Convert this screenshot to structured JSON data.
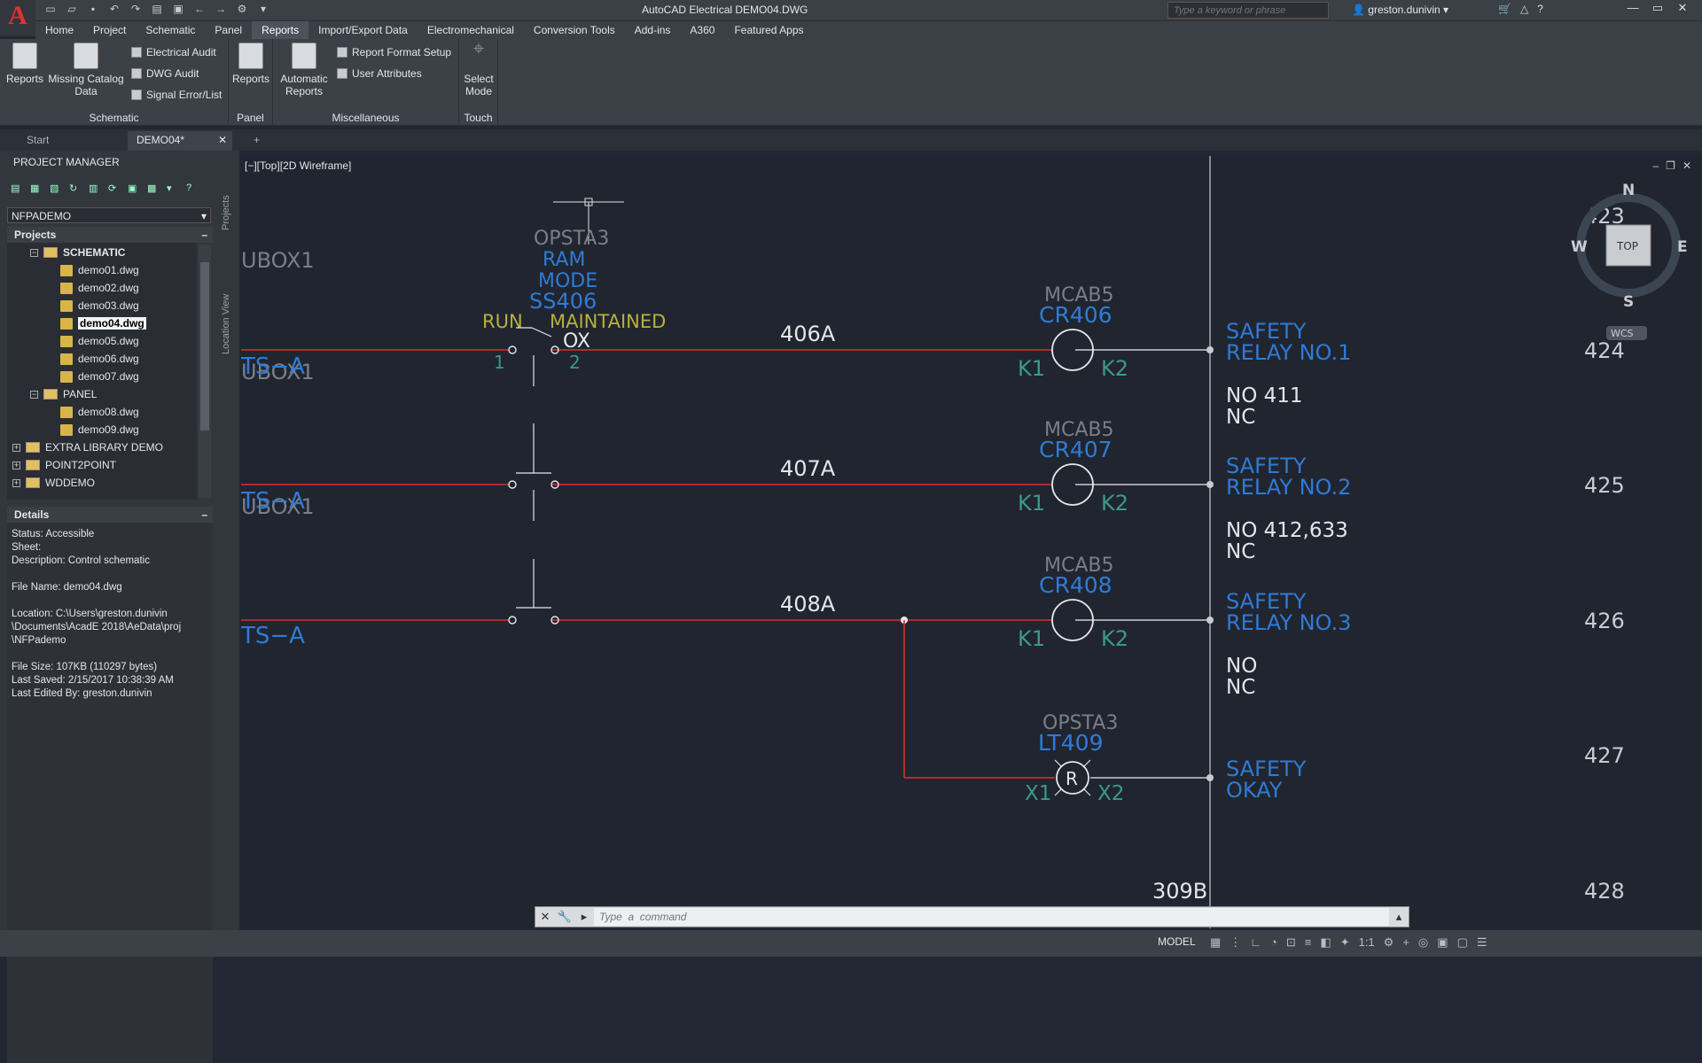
{
  "app": {
    "title": "AutoCAD Electrical   DEMO04.DWG",
    "logo": "A"
  },
  "search": {
    "placeholder": "Type a keyword or phrase"
  },
  "user": {
    "name": "greston.dunivin"
  },
  "menu": [
    "Home",
    "Project",
    "Schematic",
    "Panel",
    "Reports",
    "Import/Export Data",
    "Electromechanical",
    "Conversion Tools",
    "Add-ins",
    "A360",
    "Featured Apps"
  ],
  "menu_active": "Reports",
  "ribbon": {
    "schematic": {
      "label": "Schematic",
      "reports": "Reports",
      "missing": "Missing Catalog\nData",
      "audit": "Electrical Audit",
      "dwg_audit": "DWG Audit",
      "signal": "Signal Error/List"
    },
    "panel": {
      "label": "Panel",
      "reports": "Reports"
    },
    "misc": {
      "label": "Miscellaneous",
      "auto": "Automatic\nReports",
      "format": "Report Format Setup",
      "attrs": "User Attributes"
    },
    "touch": {
      "label": "Touch",
      "select": "Select\nMode"
    }
  },
  "tabs": {
    "start": "Start",
    "demo": "DEMO04*",
    "add": "+"
  },
  "pm": {
    "title": "PROJECT MANAGER",
    "project": "NFPADEMO",
    "projects_header": "Projects",
    "schematic": "SCHEMATIC",
    "files": [
      "demo01.dwg",
      "demo02.dwg",
      "demo03.dwg",
      "demo04.dwg",
      "demo05.dwg",
      "demo06.dwg",
      "demo07.dwg"
    ],
    "panel": "PANEL",
    "panel_files": [
      "demo08.dwg",
      "demo09.dwg"
    ],
    "others": [
      "EXTRA LIBRARY DEMO",
      "POINT2POINT",
      "WDDEMO"
    ],
    "side_projects": "Projects",
    "side_location": "Location View"
  },
  "details": {
    "header": "Details",
    "text": "Status: Accessible\nSheet:\nDescription: Control schematic\n\nFile Name: demo04.dwg\n\nLocation: C:\\Users\\greston.dunivin\n\\Documents\\AcadE 2018\\AeData\\proj\n\\NFPademo\n\nFile Size: 107KB (110297 bytes)\nLast Saved: 2/15/2017 10:38:39 AM\nLast Edited By: greston.dunivin"
  },
  "viewport": {
    "label": "[−][Top][2D Wireframe]"
  },
  "compass": {
    "n": "N",
    "s": "S",
    "e": "E",
    "w": "W",
    "top": "TOP",
    "wcs": "WCS"
  },
  "drawing": {
    "left_labels": {
      "ubox1": "UBOX1",
      "tsa": "TS−A"
    },
    "ss": {
      "tag1": "OPSTA3",
      "tag2": "RAM",
      "tag3": "MODE",
      "tag4": "SS406",
      "run": "RUN",
      "maintained": "MAINTAINED",
      "ox": "OX",
      "n1": "1",
      "n2": "2"
    },
    "wires": [
      "406A",
      "407A",
      "408A"
    ],
    "relays": [
      {
        "loc": "MCAB5",
        "tag": "CR406",
        "k1": "K1",
        "k2": "K2",
        "desc1": "SAFETY",
        "desc2": "RELAY  NO.1",
        "no": "NO 411",
        "nc": "NC",
        "line": "424"
      },
      {
        "loc": "MCAB5",
        "tag": "CR407",
        "k1": "K1",
        "k2": "K2",
        "desc1": "SAFETY",
        "desc2": "RELAY  NO.2",
        "no": "NO 412,633",
        "nc": "NC",
        "line": "425"
      },
      {
        "loc": "MCAB5",
        "tag": "CR408",
        "k1": "K1",
        "k2": "K2",
        "desc1": "SAFETY",
        "desc2": "RELAY  NO.3",
        "no": "NO",
        "nc": "NC",
        "line": "426"
      }
    ],
    "light": {
      "loc": "OPSTA3",
      "tag": "LT409",
      "r": "R",
      "x1": "X1",
      "x2": "X2",
      "desc1": "SAFETY",
      "desc2": "OKAY",
      "line": "427"
    },
    "line423": "423",
    "line428": "428",
    "wire309": "309B"
  },
  "command": {
    "placeholder": "Type  a  command"
  },
  "status": {
    "model": "MODEL",
    "scale": "1:1"
  }
}
